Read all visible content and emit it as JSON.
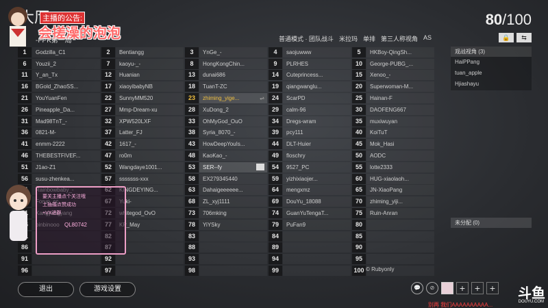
{
  "header": {
    "title": "大厅",
    "subtitle": "-FPK第一局",
    "overlay_tag": "主播的公告:",
    "overlay_text": "会搓澡的泡泡",
    "player_count": "80",
    "player_max": "/100"
  },
  "mode_bar": [
    "普通模式 · 团队战斗",
    "米拉玛",
    "单排",
    "第三人称视角",
    "AS"
  ],
  "top_icons": [
    "lock-icon",
    "swap-icon"
  ],
  "columns": [
    [
      {
        "n": "1",
        "name": "Godzilla_C1"
      },
      {
        "n": "6",
        "name": "Youzii_2"
      },
      {
        "n": "11",
        "name": "Y_an_Tx"
      },
      {
        "n": "16",
        "name": "BGold_ZhaoSS..."
      },
      {
        "n": "21",
        "name": "YouYuanFen"
      },
      {
        "n": "26",
        "name": "Pineapple_Da..."
      },
      {
        "n": "31",
        "name": "Mad98TnT_-"
      },
      {
        "n": "36",
        "name": "0821-M-"
      },
      {
        "n": "41",
        "name": "enmm-2222"
      },
      {
        "n": "46",
        "name": "THEBESTFIVEF..."
      },
      {
        "n": "51",
        "name": "J1ao-Z1"
      },
      {
        "n": "56",
        "name": "susu-zhenkea..."
      },
      {
        "n": "61",
        "name": "Rainbowbaby_-"
      },
      {
        "n": "66",
        "name": "Forun_cc"
      },
      {
        "n": "71",
        "name": "Kangyangyang"
      },
      {
        "n": "76",
        "name": "oinbinooo"
      },
      {
        "n": "81",
        "name": ""
      },
      {
        "n": "86",
        "name": ""
      },
      {
        "n": "91",
        "name": ""
      },
      {
        "n": "96",
        "name": ""
      }
    ],
    [
      {
        "n": "2",
        "name": "Bentiangg"
      },
      {
        "n": "7",
        "name": "kaoyu-_-"
      },
      {
        "n": "12",
        "name": "Huanian"
      },
      {
        "n": "17",
        "name": "xiaoyibabyNB"
      },
      {
        "n": "22",
        "name": "SunnyMM520"
      },
      {
        "n": "27",
        "name": "Mmp-Dream-xu"
      },
      {
        "n": "32",
        "name": "XPW520LXF"
      },
      {
        "n": "37",
        "name": "Latter_FJ"
      },
      {
        "n": "42",
        "name": "1617_-"
      },
      {
        "n": "47",
        "name": "ro0m"
      },
      {
        "n": "52",
        "name": "Wangdaye1001..."
      },
      {
        "n": "57",
        "name": "sssssss-xxx"
      },
      {
        "n": "62",
        "name": "KINGDEYING..."
      },
      {
        "n": "67",
        "name": "Yuki-"
      },
      {
        "n": "72",
        "name": "whitegod_OvO"
      },
      {
        "n": "77",
        "name": "KP_May"
      },
      {
        "n": "82",
        "name": ""
      },
      {
        "n": "87",
        "name": ""
      },
      {
        "n": "92",
        "name": ""
      },
      {
        "n": "97",
        "name": ""
      }
    ],
    [
      {
        "n": "3",
        "name": "YnGe_-"
      },
      {
        "n": "8",
        "name": "HongKongChin..."
      },
      {
        "n": "13",
        "name": "dunai686"
      },
      {
        "n": "18",
        "name": "TuanT-ZC"
      },
      {
        "n": "23",
        "name": "zhiming_yige..."
      },
      {
        "n": "28",
        "name": "XuDong_2"
      },
      {
        "n": "33",
        "name": "OhMyGod_OuO"
      },
      {
        "n": "38",
        "name": "Syria_8070_-"
      },
      {
        "n": "43",
        "name": "HowDeepYouIs..."
      },
      {
        "n": "48",
        "name": "KaoKao_-"
      },
      {
        "n": "53",
        "name": "SER--fy"
      },
      {
        "n": "58",
        "name": "EX279345440"
      },
      {
        "n": "63",
        "name": "Dahaigeeeeee..."
      },
      {
        "n": "68",
        "name": "ZL_xyj1111"
      },
      {
        "n": "73",
        "name": "706mking"
      },
      {
        "n": "78",
        "name": "YiYSky"
      },
      {
        "n": "83",
        "name": ""
      },
      {
        "n": "88",
        "name": ""
      },
      {
        "n": "93",
        "name": ""
      },
      {
        "n": "98",
        "name": ""
      }
    ],
    [
      {
        "n": "4",
        "name": "saojuwww"
      },
      {
        "n": "9",
        "name": "PLRHES"
      },
      {
        "n": "14",
        "name": "Cuteprincess..."
      },
      {
        "n": "19",
        "name": "qiangwanglu..."
      },
      {
        "n": "24",
        "name": "ScarPD"
      },
      {
        "n": "29",
        "name": "calm-96"
      },
      {
        "n": "34",
        "name": "Dregs-wram"
      },
      {
        "n": "39",
        "name": "pcy111"
      },
      {
        "n": "44",
        "name": "DLT-Huier"
      },
      {
        "n": "49",
        "name": "floschry"
      },
      {
        "n": "54",
        "name": "9527_PC"
      },
      {
        "n": "59",
        "name": "yizhixiaojer..."
      },
      {
        "n": "64",
        "name": "mengxmz"
      },
      {
        "n": "69",
        "name": "DouYu_18088"
      },
      {
        "n": "74",
        "name": "GuanYuTengaT..."
      },
      {
        "n": "79",
        "name": "PuFan9"
      },
      {
        "n": "84",
        "name": ""
      },
      {
        "n": "89",
        "name": ""
      },
      {
        "n": "94",
        "name": ""
      },
      {
        "n": "99",
        "name": ""
      }
    ],
    [
      {
        "n": "5",
        "name": "HKBoy-QingSh..."
      },
      {
        "n": "10",
        "name": "George-PUBG_..."
      },
      {
        "n": "15",
        "name": "Xenoo_-"
      },
      {
        "n": "20",
        "name": "Superwoman-M..."
      },
      {
        "n": "25",
        "name": "Hainan-F"
      },
      {
        "n": "30",
        "name": "DAOFENG667"
      },
      {
        "n": "35",
        "name": "muxiwuyan"
      },
      {
        "n": "40",
        "name": "KoiTuT"
      },
      {
        "n": "45",
        "name": "Mok_Hasi"
      },
      {
        "n": "50",
        "name": "AODC"
      },
      {
        "n": "55",
        "name": "lotte2333"
      },
      {
        "n": "60",
        "name": "HUG-xiaolaoh..."
      },
      {
        "n": "65",
        "name": "JN-XiaoPang"
      },
      {
        "n": "70",
        "name": "zhiming_yiji..."
      },
      {
        "n": "75",
        "name": "Ruin-Anran"
      },
      {
        "n": "80",
        "name": ""
      },
      {
        "n": "85",
        "name": ""
      },
      {
        "n": "90",
        "name": ""
      },
      {
        "n": "95",
        "name": ""
      },
      {
        "n": "100",
        "name": ""
      }
    ]
  ],
  "spectators": {
    "header": "观战视角 (3)",
    "items": [
      "HaiPPang",
      "tuan_apple",
      "Hjiashayu"
    ]
  },
  "unassigned": "未分配 (0)",
  "buttons": {
    "exit": "退出",
    "settings": "游戏设置"
  },
  "ruby_label": "© Rubyonly",
  "cam_overlay": {
    "lines": [
      "要关主播点个关注哦",
      "土抽搐点赞成功",
      "+VX进群"
    ],
    "id": "QL80742"
  },
  "watermark": {
    "brand": "斗鱼",
    "site": "DOUYU.COM"
  },
  "ticker": "别再 我们AAAAAAAAAA..."
}
